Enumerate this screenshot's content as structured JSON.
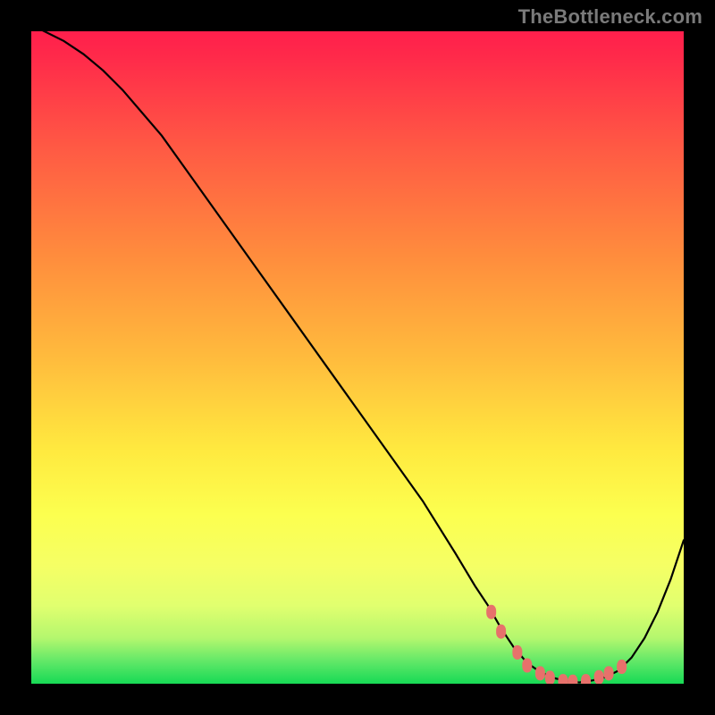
{
  "watermark": "TheBottleneck.com",
  "colors": {
    "background_border": "#000000",
    "curve": "#000000",
    "marker": "#e7716b",
    "gradient_top": "#ff1f4c",
    "gradient_mid_upper": "#ff8b3d",
    "gradient_mid": "#ffe93f",
    "gradient_lower": "#f5ff65",
    "gradient_bottom": "#17da55"
  },
  "chart_data": {
    "type": "line",
    "title": "",
    "xlabel": "",
    "ylabel": "",
    "xlim": [
      0,
      100
    ],
    "ylim": [
      0,
      100
    ],
    "x": [
      0,
      2,
      5,
      8,
      11,
      14,
      17,
      20,
      25,
      30,
      35,
      40,
      45,
      50,
      55,
      60,
      65,
      68,
      70,
      72,
      74,
      76,
      78,
      80,
      82,
      84,
      86,
      88,
      90,
      92,
      94,
      96,
      98,
      100
    ],
    "y": [
      101,
      100,
      98.5,
      96.5,
      94,
      91,
      87.5,
      84,
      77,
      70,
      63,
      56,
      49,
      42,
      35,
      28,
      20,
      15,
      12,
      8.5,
      5.5,
      3.2,
      1.8,
      0.9,
      0.4,
      0.2,
      0.5,
      1.0,
      2.0,
      4.0,
      7.0,
      11.0,
      16.0,
      22.0
    ],
    "markers": {
      "x": [
        70.5,
        72,
        74.5,
        76,
        78,
        79.5,
        81.5,
        83,
        85,
        87,
        88.5,
        90.5
      ],
      "y": [
        11.0,
        8.0,
        4.8,
        2.8,
        1.6,
        0.9,
        0.4,
        0.3,
        0.4,
        1.0,
        1.6,
        2.6
      ]
    },
    "gradient_stops": [
      {
        "offset": 0.0,
        "color": "#ff1f4c"
      },
      {
        "offset": 0.04,
        "color": "#ff2a4a"
      },
      {
        "offset": 0.18,
        "color": "#ff5a44"
      },
      {
        "offset": 0.34,
        "color": "#ff8b3d"
      },
      {
        "offset": 0.5,
        "color": "#ffbb3d"
      },
      {
        "offset": 0.64,
        "color": "#ffe93f"
      },
      {
        "offset": 0.74,
        "color": "#fcff4f"
      },
      {
        "offset": 0.82,
        "color": "#f5ff65"
      },
      {
        "offset": 0.88,
        "color": "#e1ff6f"
      },
      {
        "offset": 0.93,
        "color": "#b4f76e"
      },
      {
        "offset": 0.965,
        "color": "#63e868"
      },
      {
        "offset": 1.0,
        "color": "#17da55"
      }
    ]
  }
}
